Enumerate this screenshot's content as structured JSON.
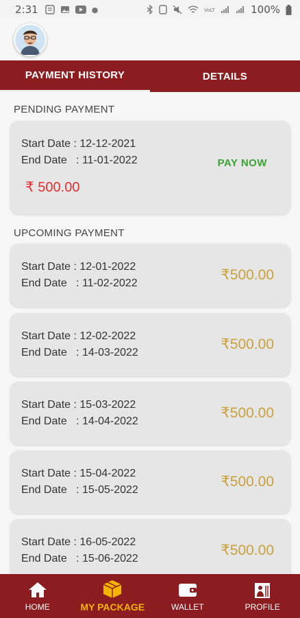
{
  "status_bar": {
    "time": "2:31",
    "battery": "100%"
  },
  "tabs": [
    {
      "label": "PAYMENT HISTORY"
    },
    {
      "label": "DETAILS"
    }
  ],
  "pending": {
    "title": "PENDING PAYMENT",
    "start_date": "Start Date : 12-12-2021",
    "end_date": "End Date   : 11-01-2022",
    "amount": "₹ 500.00",
    "action": "PAY NOW"
  },
  "upcoming": {
    "title": "UPCOMING PAYMENT",
    "items": [
      {
        "start_date": "Start Date : 12-01-2022",
        "end_date": "End Date   : 11-02-2022",
        "amount": "₹500.00"
      },
      {
        "start_date": "Start Date : 12-02-2022",
        "end_date": "End Date   : 14-03-2022",
        "amount": "₹500.00"
      },
      {
        "start_date": "Start Date : 15-03-2022",
        "end_date": "End Date   : 14-04-2022",
        "amount": "₹500.00"
      },
      {
        "start_date": "Start Date : 15-04-2022",
        "end_date": "End Date   : 15-05-2022",
        "amount": "₹500.00"
      },
      {
        "start_date": "Start Date : 16-05-2022",
        "end_date": "End Date   : 15-06-2022",
        "amount": "₹500.00"
      }
    ]
  },
  "bottom_nav": [
    {
      "label": "HOME",
      "icon": "home-icon"
    },
    {
      "label": "MY PACKAGE",
      "icon": "package-icon"
    },
    {
      "label": "WALLET",
      "icon": "wallet-icon"
    },
    {
      "label": "PROFILE",
      "icon": "profile-icon"
    }
  ],
  "colors": {
    "brand": "#8b1c1f",
    "gold": "#c9a13d",
    "pay_now": "#3aa335",
    "pending_amount": "#e53030",
    "active_nav": "#f4b400"
  }
}
